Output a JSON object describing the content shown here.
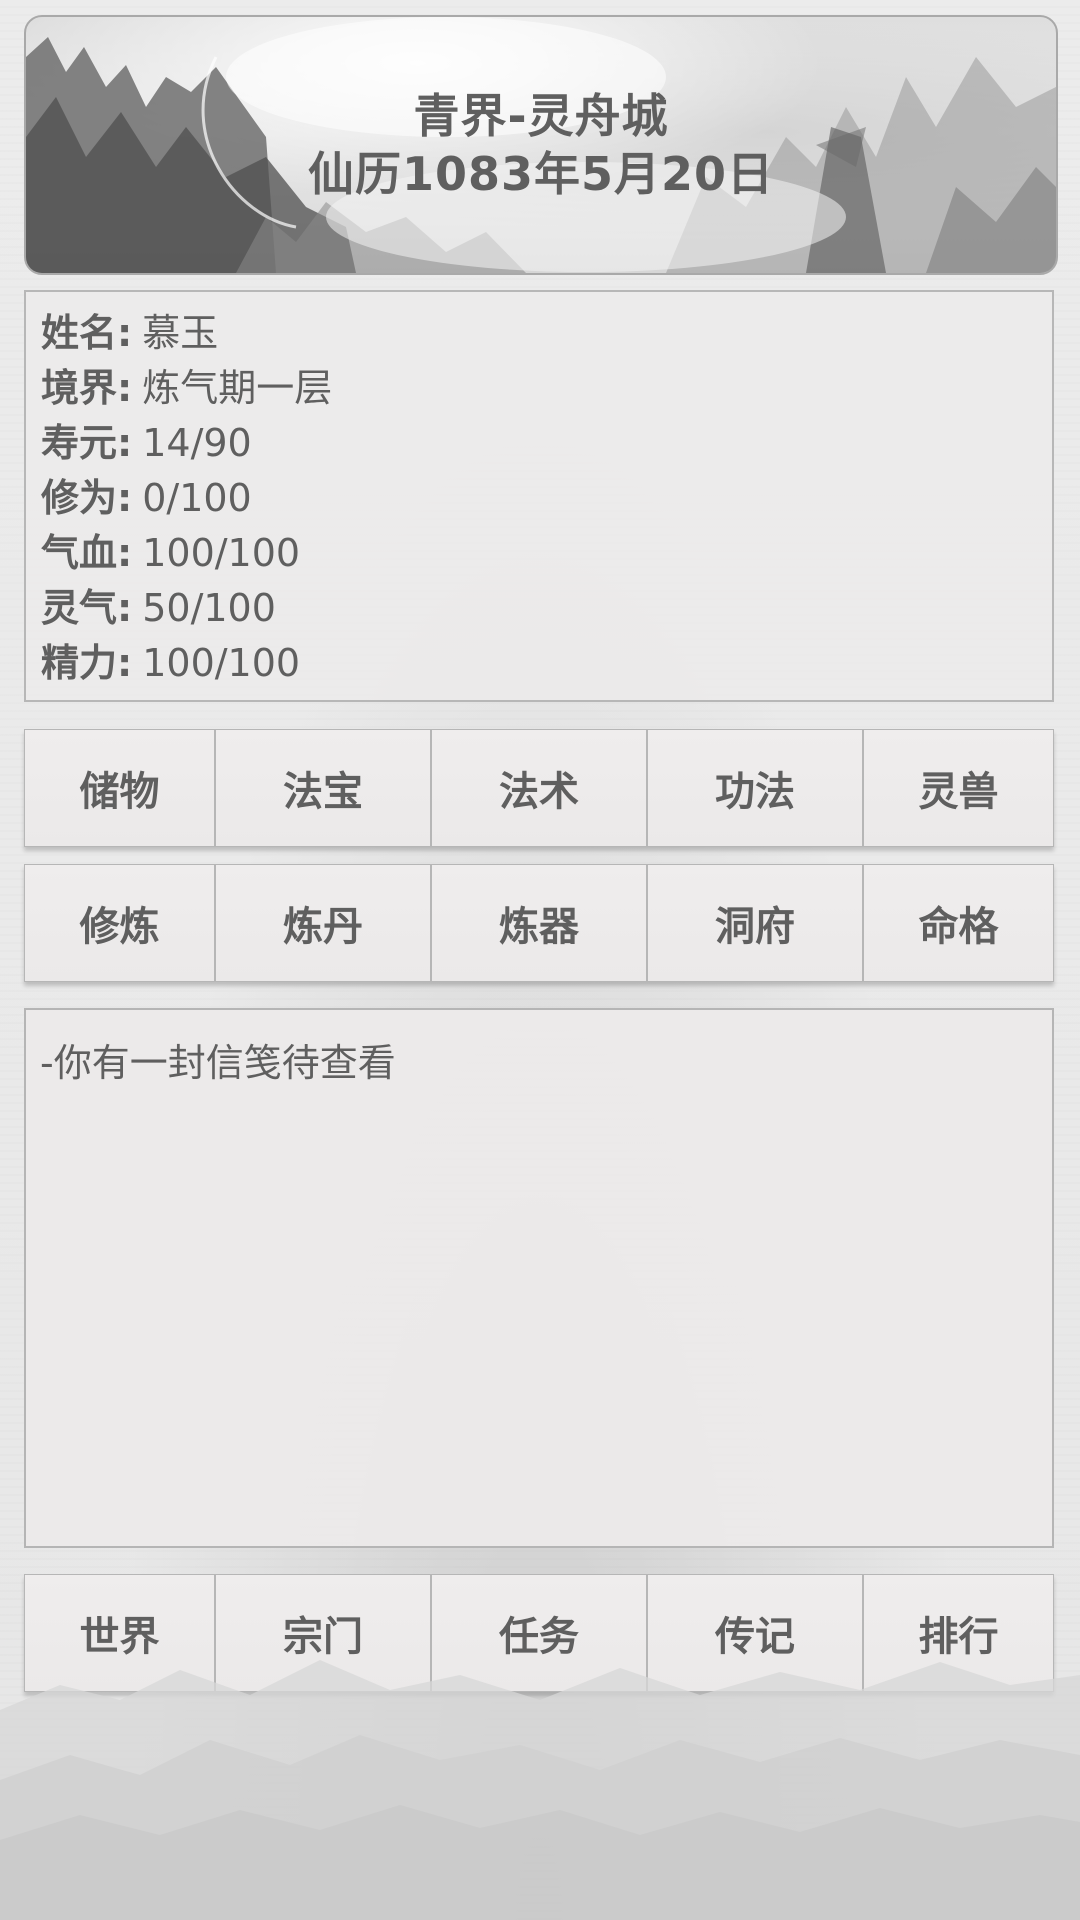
{
  "header": {
    "location": "青界-灵舟城",
    "date": "仙历1083年5月20日"
  },
  "character": {
    "rows": [
      {
        "label": "姓名",
        "value": "慕玉"
      },
      {
        "label": "境界",
        "value": "炼气期一层"
      },
      {
        "label": "寿元",
        "value": "14/90"
      },
      {
        "label": "修为",
        "value": "0/100"
      },
      {
        "label": "气血",
        "value": "100/100"
      },
      {
        "label": "灵气",
        "value": "50/100"
      },
      {
        "label": "精力",
        "value": "100/100"
      }
    ],
    "colon": ":"
  },
  "menu_row_1": [
    "储物",
    "法宝",
    "法术",
    "功法",
    "灵兽"
  ],
  "menu_row_2": [
    "修炼",
    "炼丹",
    "炼器",
    "洞府",
    "命格"
  ],
  "log": {
    "lines": [
      "-你有一封信笺待查看"
    ]
  },
  "nav_row": [
    "世界",
    "宗门",
    "任务",
    "传记",
    "排行"
  ]
}
